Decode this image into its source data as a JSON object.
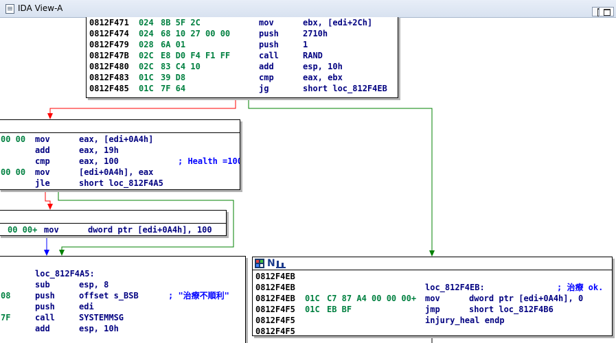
{
  "window": {
    "tab_title": "IDA View-A"
  },
  "colors": {
    "address": "#000000",
    "bytes": "#008040",
    "instruction": "#000080",
    "number": "#008040",
    "comment": "#0000ff",
    "edge_true": "#008000",
    "edge_false": "#ff0000",
    "edge_uncond": "#0000ff"
  },
  "icons": [
    "tab-icon",
    "restore-icon",
    "maximize-icon",
    "node-color-icon",
    "node-name-icon",
    "node-group-icon"
  ],
  "node_top": {
    "lines": [
      {
        "addr": "0812F471",
        "sp": "024",
        "bytes": "8B 5F 2C",
        "mnem": "mov",
        "ops": "ebx, [edi+2Ch]"
      },
      {
        "addr": "0812F474",
        "sp": "024",
        "bytes": "68 10 27 00 00",
        "mnem": "push",
        "ops": "2710h"
      },
      {
        "addr": "0812F479",
        "sp": "028",
        "bytes": "6A 01",
        "mnem": "push",
        "ops": "1"
      },
      {
        "addr": "0812F47B",
        "sp": "02C",
        "bytes": "E8 D0 F4 F1 FF",
        "mnem": "call",
        "ops": "RAND"
      },
      {
        "addr": "0812F480",
        "sp": "02C",
        "bytes": "83 C4 10",
        "mnem": "add",
        "ops": "esp, 10h"
      },
      {
        "addr": "0812F483",
        "sp": "01C",
        "bytes": "39 D8",
        "mnem": "cmp",
        "ops": "eax, ebx"
      },
      {
        "addr": "0812F485",
        "sp": "01C",
        "bytes": "7F 64",
        "mnem": "jg",
        "ops": "short loc_812F4EB"
      }
    ]
  },
  "node_health": {
    "lines": [
      {
        "prefix": "00 00",
        "mnem": "mov",
        "ops": "eax, [edi+0A4h]",
        "comment": ""
      },
      {
        "prefix": "",
        "mnem": "add",
        "ops": "eax, 19h",
        "comment": ""
      },
      {
        "prefix": "",
        "mnem": "cmp",
        "ops": "eax, 100",
        "comment": "; Health =100"
      },
      {
        "prefix": "00 00",
        "mnem": "mov",
        "ops": "[edi+0A4h], eax",
        "comment": ""
      },
      {
        "prefix": "",
        "mnem": "jle",
        "ops": "short loc_812F4A5",
        "comment": ""
      }
    ]
  },
  "node_set_health": {
    "line": {
      "prefix": "00 00+",
      "mnem": "mov",
      "ops": "dword ptr [edi+0A4h], 100"
    }
  },
  "node_loc_4a5": {
    "lines": [
      {
        "prefix": "",
        "mnem": "",
        "ops": "",
        "comment": ""
      },
      {
        "prefix": "",
        "mnem": "loc_812F4A5:",
        "ops": "",
        "comment": ""
      },
      {
        "prefix": "",
        "mnem": "sub",
        "ops": "esp, 8",
        "comment": ""
      },
      {
        "prefix": "08",
        "mnem": "push",
        "ops": "offset s_BSB",
        "comment": "; \"治療不順利\""
      },
      {
        "prefix": "",
        "mnem": "push",
        "ops": "edi",
        "comment": ""
      },
      {
        "prefix": "7F",
        "mnem": "call",
        "ops": "SYSTEMMSG",
        "comment": ""
      },
      {
        "prefix": "",
        "mnem": "add",
        "ops": "esp, 10h",
        "comment": ""
      }
    ]
  },
  "node_loc_4eb": {
    "header_text": "N ul",
    "lines": [
      {
        "addr": "0812F4EB",
        "sp": "",
        "bytes": "",
        "mnem": "",
        "ops": "",
        "comment": ""
      },
      {
        "addr": "0812F4EB",
        "sp": "",
        "bytes": "",
        "mnem": "loc_812F4EB:",
        "ops": "",
        "comment": "; 治療 ok."
      },
      {
        "addr": "0812F4EB",
        "sp": "01C",
        "bytes": "C7 87 A4 00 00 00+",
        "mnem": "mov",
        "ops": "dword ptr [edi+0A4h], 0",
        "comment": ""
      },
      {
        "addr": "0812F4F5",
        "sp": "01C",
        "bytes": "EB BF",
        "mnem": "jmp",
        "ops": "short loc_812F4B6",
        "comment": ""
      },
      {
        "addr": "0812F4F5",
        "sp": "",
        "bytes": "",
        "mnem": "injury_heal endp",
        "ops": "",
        "comment": ""
      },
      {
        "addr": "0812F4F5",
        "sp": "",
        "bytes": "",
        "mnem": "",
        "ops": "",
        "comment": ""
      }
    ]
  }
}
